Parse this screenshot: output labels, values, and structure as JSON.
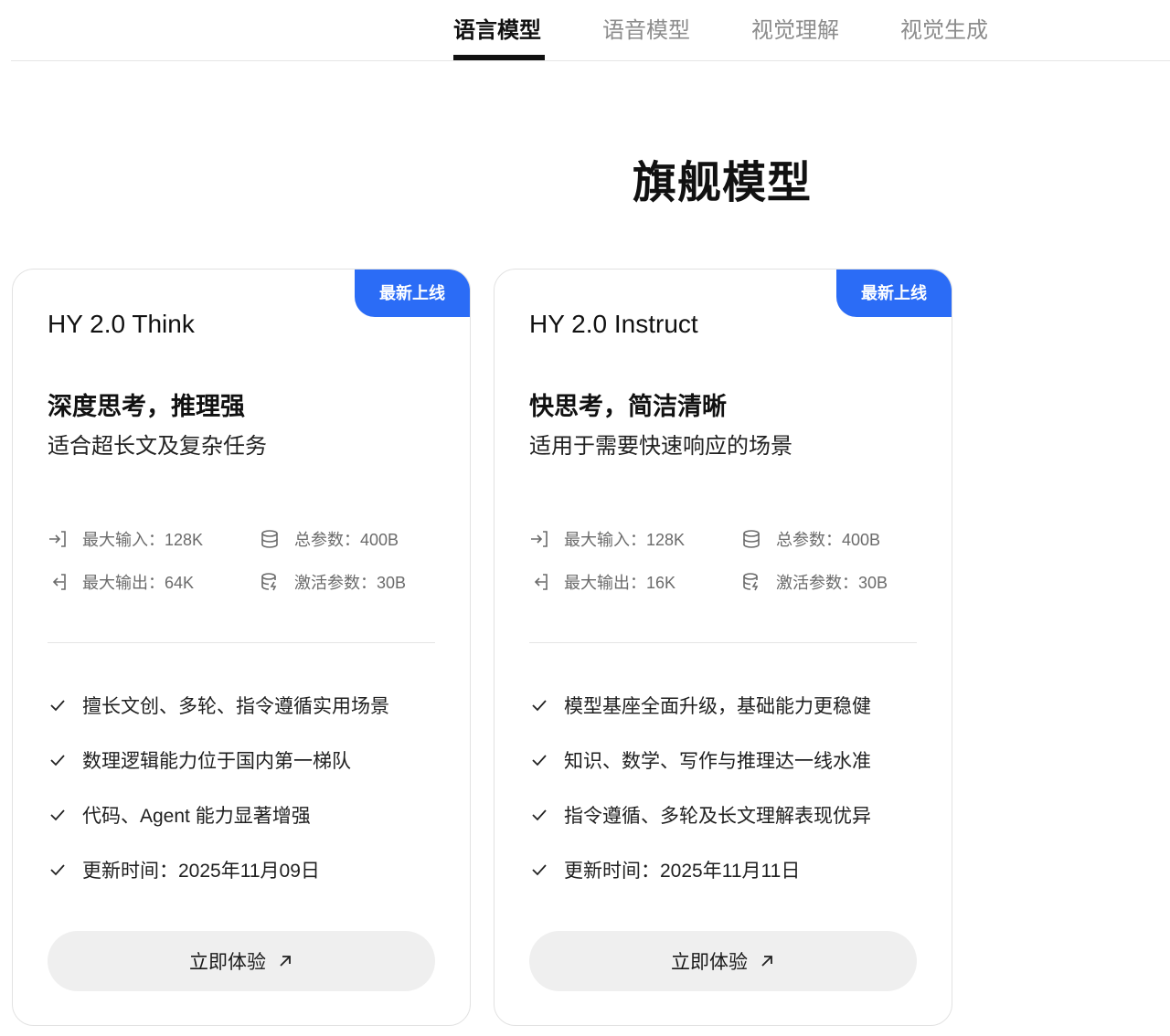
{
  "tabs": [
    {
      "label": "语言模型",
      "active": true
    },
    {
      "label": "语音模型",
      "active": false
    },
    {
      "label": "视觉理解",
      "active": false
    },
    {
      "label": "视觉生成",
      "active": false
    }
  ],
  "section_title": "旗舰模型",
  "cards": [
    {
      "badge": "最新上线",
      "name": "HY 2.0 Think",
      "tagline": "深度思考，推理强",
      "desc": "适合超长文及复杂任务",
      "specs": {
        "max_input": "最大输入：128K",
        "total_params": "总参数：400B",
        "max_output": "最大输出：64K",
        "active_params": "激活参数：30B"
      },
      "features": [
        "擅长文创、多轮、指令遵循实用场景",
        "数理逻辑能力位于国内第一梯队",
        "代码、Agent 能力显著增强",
        "更新时间：2025年11月09日"
      ],
      "cta": "立即体验"
    },
    {
      "badge": "最新上线",
      "name": "HY 2.0 Instruct",
      "tagline": "快思考，简洁清晰",
      "desc": "适用于需要快速响应的场景",
      "specs": {
        "max_input": "最大输入：128K",
        "total_params": "总参数：400B",
        "max_output": "最大输出：16K",
        "active_params": "激活参数：30B"
      },
      "features": [
        "模型基座全面升级，基础能力更稳健",
        "知识、数学、写作与推理达一线水准",
        "指令遵循、多轮及长文理解表现优异",
        "更新时间：2025年11月11日"
      ],
      "cta": "立即体验"
    }
  ],
  "colors": {
    "accent": "#2b6cf6",
    "active_tab": "#111111",
    "inactive_tab": "#8c8c8c",
    "button_bg": "#efefef"
  }
}
